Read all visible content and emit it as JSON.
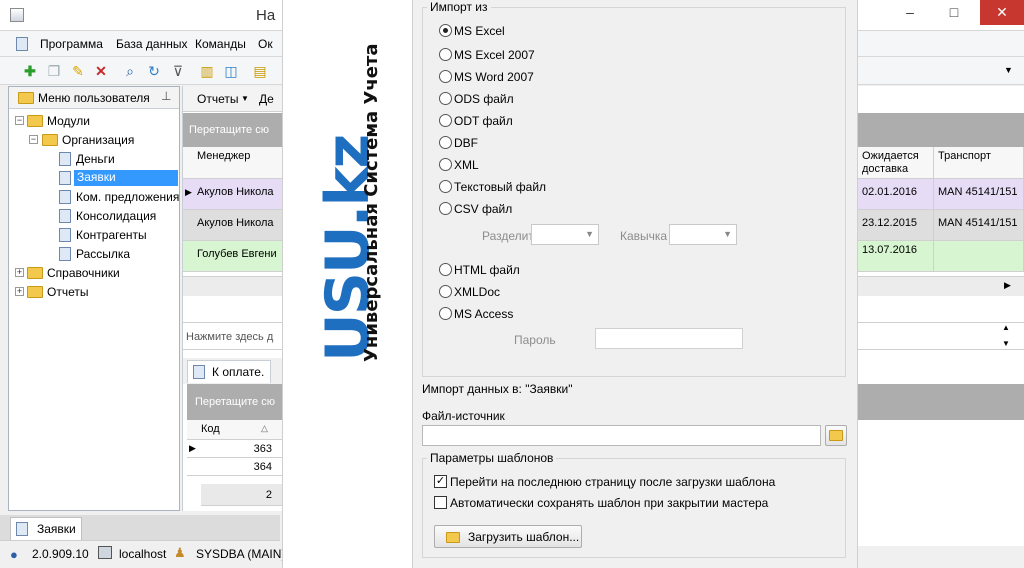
{
  "app": {
    "title_fragment": "На",
    "menu": [
      "Программа",
      "База данных",
      "Команды",
      "Ок"
    ],
    "user_menu_label": "Меню пользователя",
    "tree": {
      "modules": "Модули",
      "organization": "Организация",
      "money": "Деньги",
      "requests": "Заявки",
      "offers": "Ком. предложения",
      "consolidation": "Консолидация",
      "contractors": "Контрагенты",
      "mailing": "Рассылка",
      "references": "Справочники",
      "reports": "Отчеты"
    },
    "reports_tab": "Отчеты",
    "reports_tab_next": "Де",
    "drag_hint": "Перетащите сю",
    "manager_header": "Менеджер",
    "managers": [
      "Акулов Никола",
      "Акулов Никола",
      "Голубев Евгени"
    ],
    "click_hint": "Нажмите здесь д",
    "payment_tab": "К оплате.",
    "drag_hint_2": "Перетащите сю",
    "code_header": "Код",
    "codes": [
      "363",
      "364"
    ],
    "total": "2",
    "right_headers": [
      "Ожидается доставка",
      "Транспорт"
    ],
    "right_rows": [
      {
        "date": "02.01.2016",
        "transport": "MAN 45141/151"
      },
      {
        "date": "23.12.2015",
        "transport": "MAN 45141/151"
      },
      {
        "date": "13.07.2016",
        "transport": ""
      }
    ],
    "bottom_tab": "Заявки",
    "status": {
      "version": "2.0.909.10",
      "host": "localhost",
      "user": "SYSDBA (MAIN)"
    }
  },
  "logo": {
    "main": "USU.kz",
    "tagline": "Универсальная Система Учета"
  },
  "dialog": {
    "import_from_title": "Импорт из",
    "formats": [
      "MS Excel",
      "MS Excel 2007",
      "MS Word 2007",
      "ODS файл",
      "ODT файл",
      "DBF",
      "XML",
      "Текстовый файл",
      "CSV файл",
      "HTML файл",
      "XMLDoc",
      "MS Access"
    ],
    "selected_format": "MS Excel",
    "separator_label": "Разделит",
    "quote_label": "Кавычка",
    "password_label": "Пароль",
    "import_into": "Импорт данных в: \"Заявки\"",
    "source_file_label": "Файл-источник",
    "source_file_value": "",
    "template_params_title": "Параметры шаблонов",
    "goto_last_page": "Перейти на последнюю страницу после загрузки шаблона",
    "goto_last_page_checked": true,
    "autosave_template": "Автоматически сохранять шаблон при закрытии мастера",
    "autosave_template_checked": false,
    "load_template_button": "Загрузить шаблон..."
  },
  "colors": {
    "logo_blue": "#1f6fc0",
    "row_purple": "#e6dcf5",
    "row_gray": "#dedede",
    "row_green": "#d7f5d0",
    "selection_blue": "#3399ff"
  }
}
